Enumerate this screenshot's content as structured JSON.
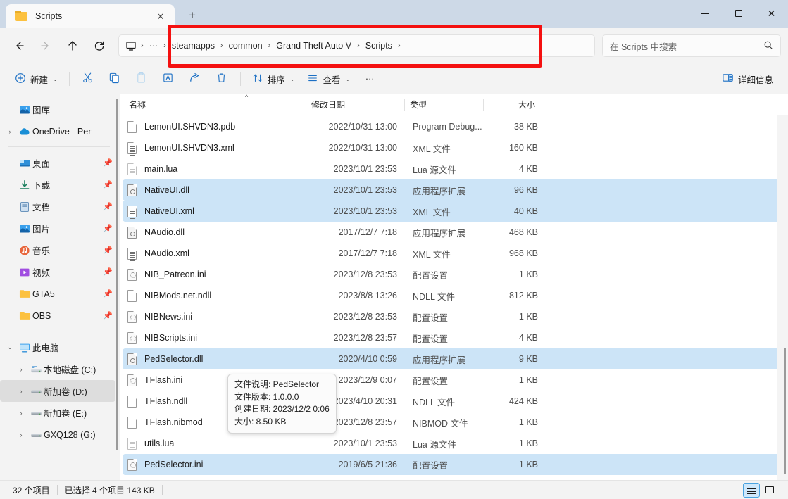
{
  "window": {
    "tab_title": "Scripts",
    "tab_icon": "folder-icon",
    "close_tab_label": "✕",
    "new_tab_label": "+",
    "minimize_label": "minimize",
    "maximize_label": "maximize",
    "close_label": "✕"
  },
  "nav": {
    "back_label": "后退",
    "forward_label": "前进",
    "up_label": "向上",
    "refresh_label": "刷新",
    "pc_icon_label": "此电脑"
  },
  "breadcrumb": {
    "leading_sep": "›",
    "overflow": "···",
    "items": [
      "steamapps",
      "common",
      "Grand Theft Auto V",
      "Scripts"
    ],
    "trailing_sep": "›"
  },
  "search": {
    "placeholder": "在 Scripts 中搜索",
    "icon": "search-icon"
  },
  "toolbar": {
    "new_label": "新建",
    "cut_label": "剪切",
    "copy_label": "复制",
    "paste_label": "粘贴",
    "rename_label": "重命名",
    "share_label": "共享",
    "delete_label": "删除",
    "sort_label": "排序",
    "view_label": "查看",
    "more_label": "···",
    "details_label": "详细信息",
    "chevron": "⌄"
  },
  "sidebar": {
    "items": [
      {
        "label": "图库",
        "icon": "gallery-icon",
        "expand": "",
        "pin": false,
        "selected": false
      },
      {
        "label": "OneDrive - Per",
        "icon": "onedrive-icon",
        "expand": "›",
        "pin": false,
        "selected": false
      },
      {
        "sep": true
      },
      {
        "label": "桌面",
        "icon": "desktop-icon",
        "expand": "",
        "pin": true,
        "selected": false
      },
      {
        "label": "下载",
        "icon": "downloads-icon",
        "expand": "",
        "pin": true,
        "selected": false
      },
      {
        "label": "文档",
        "icon": "documents-icon",
        "expand": "",
        "pin": true,
        "selected": false
      },
      {
        "label": "图片",
        "icon": "pictures-icon",
        "expand": "",
        "pin": true,
        "selected": false
      },
      {
        "label": "音乐",
        "icon": "music-icon",
        "expand": "",
        "pin": true,
        "selected": false
      },
      {
        "label": "视频",
        "icon": "videos-icon",
        "expand": "",
        "pin": true,
        "selected": false
      },
      {
        "label": "GTA5",
        "icon": "folder-icon",
        "expand": "",
        "pin": true,
        "selected": false
      },
      {
        "label": "OBS",
        "icon": "folder-icon",
        "expand": "",
        "pin": true,
        "selected": false
      },
      {
        "sep": true
      },
      {
        "label": "此电脑",
        "icon": "this-pc-icon",
        "expand": "⌄",
        "pin": false,
        "selected": false
      },
      {
        "label": "本地磁盘 (C:)",
        "icon": "system-drive-icon",
        "expand": "›",
        "pin": false,
        "selected": false
      },
      {
        "label": "新加卷 (D:)",
        "icon": "drive-icon",
        "expand": "›",
        "pin": false,
        "selected": true
      },
      {
        "label": "新加卷 (E:)",
        "icon": "drive-icon",
        "expand": "›",
        "pin": false,
        "selected": false
      },
      {
        "label": "GXQ128 (G:)",
        "icon": "drive-icon",
        "expand": "›",
        "pin": false,
        "selected": false
      }
    ]
  },
  "filelist": {
    "columns": {
      "name": "名称",
      "date": "修改日期",
      "type": "类型",
      "size": "大小"
    },
    "sort_indicator": "^",
    "rows": [
      {
        "name": "LemonUI.SHVDN3.pdb",
        "date": "2022/10/31 13:00",
        "type": "Program Debug...",
        "size": "38 KB",
        "icon": "blank-file-icon",
        "selected": false
      },
      {
        "name": "LemonUI.SHVDN3.xml",
        "date": "2022/10/31 13:00",
        "type": "XML 文件",
        "size": "160 KB",
        "icon": "xml-file-icon",
        "selected": false
      },
      {
        "name": "main.lua",
        "date": "2023/10/1 23:53",
        "type": "Lua 源文件",
        "size": "4 KB",
        "icon": "lua-file-icon",
        "selected": false
      },
      {
        "name": "NativeUI.dll",
        "date": "2023/10/1 23:53",
        "type": "应用程序扩展",
        "size": "96 KB",
        "icon": "dll-file-icon",
        "selected": true
      },
      {
        "name": "NativeUI.xml",
        "date": "2023/10/1 23:53",
        "type": "XML 文件",
        "size": "40 KB",
        "icon": "xml-file-icon",
        "selected": true
      },
      {
        "name": "NAudio.dll",
        "date": "2017/12/7 7:18",
        "type": "应用程序扩展",
        "size": "468 KB",
        "icon": "dll-file-icon",
        "selected": false
      },
      {
        "name": "NAudio.xml",
        "date": "2017/12/7 7:18",
        "type": "XML 文件",
        "size": "968 KB",
        "icon": "xml-file-icon",
        "selected": false
      },
      {
        "name": "NIB_Patreon.ini",
        "date": "2023/12/8 23:53",
        "type": "配置设置",
        "size": "1 KB",
        "icon": "ini-file-icon",
        "selected": false
      },
      {
        "name": "NIBMods.net.ndll",
        "date": "2023/8/8 13:26",
        "type": "NDLL 文件",
        "size": "812 KB",
        "icon": "blank-file-icon",
        "selected": false
      },
      {
        "name": "NIBNews.ini",
        "date": "2023/12/8 23:53",
        "type": "配置设置",
        "size": "1 KB",
        "icon": "ini-file-icon",
        "selected": false
      },
      {
        "name": "NIBScripts.ini",
        "date": "2023/12/8 23:57",
        "type": "配置设置",
        "size": "4 KB",
        "icon": "ini-file-icon",
        "selected": false
      },
      {
        "name": "PedSelector.dll",
        "date": "2020/4/10 0:59",
        "type": "应用程序扩展",
        "size": "9 KB",
        "icon": "dll-file-icon",
        "selected": true
      },
      {
        "name": "TFlash.ini",
        "date": "2023/12/9 0:07",
        "type": "配置设置",
        "size": "1 KB",
        "icon": "ini-file-icon",
        "selected": false
      },
      {
        "name": "TFlash.ndll",
        "date": "2023/4/10 20:31",
        "type": "NDLL 文件",
        "size": "424 KB",
        "icon": "blank-file-icon",
        "selected": false
      },
      {
        "name": "TFlash.nibmod",
        "date": "2023/12/8 23:57",
        "type": "NIBMOD 文件",
        "size": "1 KB",
        "icon": "blank-file-icon",
        "selected": false
      },
      {
        "name": "utils.lua",
        "date": "2023/10/1 23:53",
        "type": "Lua 源文件",
        "size": "1 KB",
        "icon": "lua-file-icon",
        "selected": false
      },
      {
        "name": "PedSelector.ini",
        "date": "2019/6/5 21:36",
        "type": "配置设置",
        "size": "1 KB",
        "icon": "ini-file-icon",
        "selected": true
      }
    ]
  },
  "tooltip": {
    "lines": [
      "文件说明: PedSelector",
      "文件版本: 1.0.0.0",
      "创建日期: 2023/12/2 0:06",
      "大小: 8.50 KB"
    ]
  },
  "statusbar": {
    "item_count": "32 个项目",
    "selection": "已选择 4 个项目  143 KB",
    "details_view_label": "详细信息视图",
    "large_icons_label": "大图标视图"
  },
  "colors": {
    "accent": "#0f6cbd",
    "selection": "#cce4f7",
    "annotation": "#f41010",
    "titlebar": "#cdd9e7"
  }
}
